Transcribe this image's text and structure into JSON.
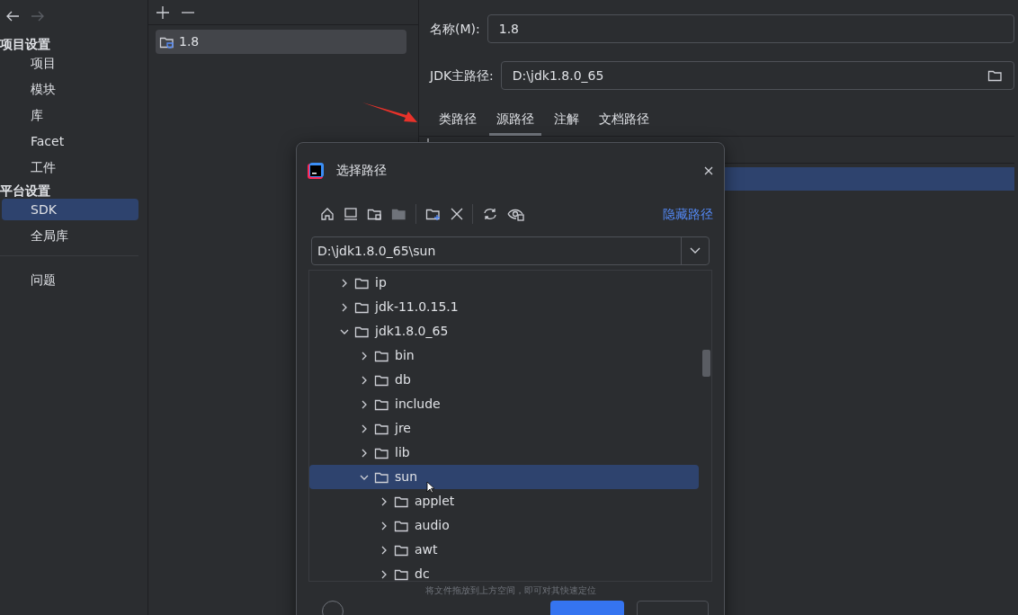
{
  "nav": [
    {
      "kind": "back",
      "disabled": false
    },
    {
      "kind": "forward",
      "disabled": true
    }
  ],
  "sidebar": {
    "sections": [
      {
        "title": "项目设置",
        "items": [
          {
            "label": "项目",
            "selected": false
          },
          {
            "label": "模块",
            "selected": false
          },
          {
            "label": "库",
            "selected": false
          },
          {
            "label": "Facet",
            "selected": false
          },
          {
            "label": "工件",
            "selected": false
          }
        ]
      },
      {
        "title": "平台设置",
        "items": [
          {
            "label": "SDK",
            "selected": true
          },
          {
            "label": "全局库",
            "selected": false
          }
        ]
      },
      {
        "items": [
          {
            "label": "问题",
            "selected": false
          }
        ]
      }
    ]
  },
  "sdk_list": [
    {
      "label": "1.8",
      "selected": true
    }
  ],
  "form": {
    "name_label": "名称(M):",
    "name_value": "1.8",
    "home_label": "JDK主路径:",
    "home_value": "D:\\jdk1.8.0_65"
  },
  "tabs": [
    {
      "label": "类路径",
      "selected": false
    },
    {
      "label": "源路径",
      "selected": true
    },
    {
      "label": "注解",
      "selected": false
    },
    {
      "label": "文档路径",
      "selected": false
    }
  ],
  "dialog": {
    "title": "选择路径",
    "hide_path_link": "隐藏路径",
    "path_value": "D:\\jdk1.8.0_65\\sun",
    "hint": "将文件拖放到上方空间，即可对其快速定位",
    "tree": [
      {
        "label": "ip",
        "expanded": false,
        "selected": false
      },
      {
        "label": "jdk-11.0.15.1",
        "expanded": false,
        "selected": false
      },
      {
        "label": "jdk1.8.0_65",
        "expanded": true,
        "selected": false,
        "children": [
          {
            "label": "bin",
            "expanded": false,
            "selected": false
          },
          {
            "label": "db",
            "expanded": false,
            "selected": false
          },
          {
            "label": "include",
            "expanded": false,
            "selected": false
          },
          {
            "label": "jre",
            "expanded": false,
            "selected": false
          },
          {
            "label": "lib",
            "expanded": false,
            "selected": false
          },
          {
            "label": "sun",
            "expanded": true,
            "selected": true,
            "children": [
              {
                "label": "applet",
                "expanded": false,
                "selected": false
              },
              {
                "label": "audio",
                "expanded": false,
                "selected": false
              },
              {
                "label": "awt",
                "expanded": false,
                "selected": false
              },
              {
                "label": "dc",
                "expanded": false,
                "selected": false
              }
            ]
          }
        ]
      }
    ]
  }
}
